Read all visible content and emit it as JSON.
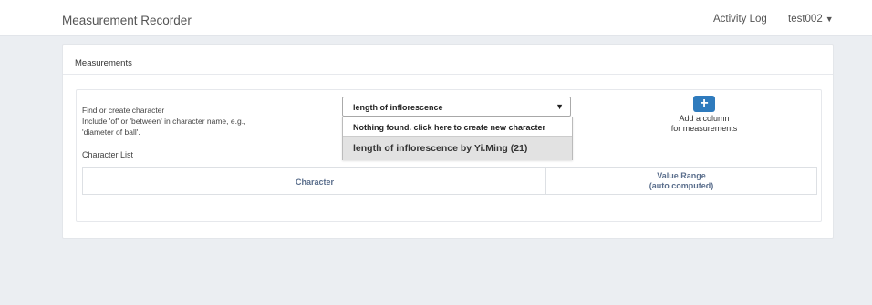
{
  "app": {
    "title": "Measurement Recorder",
    "nav_activity_log": "Activity Log",
    "user_name": "test002"
  },
  "panel": {
    "title": "Measurements"
  },
  "finder": {
    "help_line1": "Find or create character",
    "help_line2": "Include 'of' or 'between' in character name, e.g.,",
    "help_line3": "'diameter of ball'.",
    "character_list_label": "Character List"
  },
  "select": {
    "value": "length of inflorescence",
    "options": {
      "create_new": "Nothing found. click here to create new character",
      "match": "length of inflorescence by Yi.Ming (21)"
    }
  },
  "add_column": {
    "icon": "plus-icon",
    "label_line1": "Add a column",
    "label_line2": "for measurements"
  },
  "table": {
    "headers": {
      "character": "Character",
      "value_range_line1": "Value Range",
      "value_range_line2": "(auto computed)"
    }
  },
  "colors": {
    "accent": "#2f7bbd",
    "table_header_text": "#5a6e8c",
    "background": "#ebeef2"
  }
}
